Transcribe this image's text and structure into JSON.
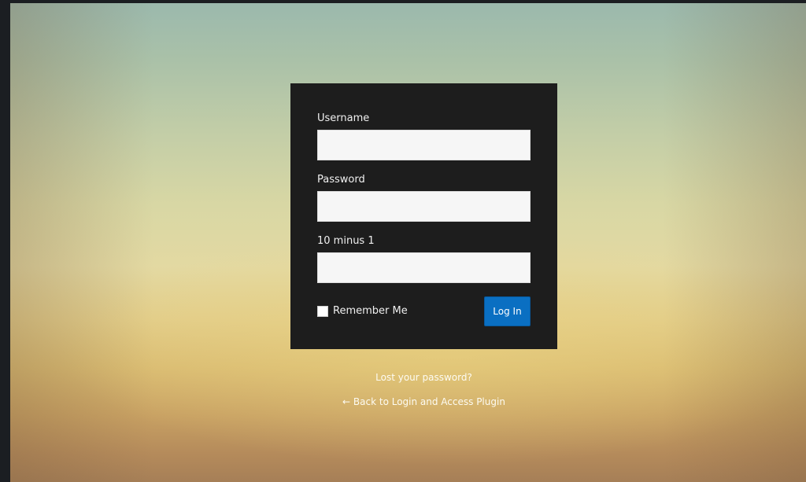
{
  "login_form": {
    "username_label": "Username",
    "username_value": "",
    "password_label": "Password",
    "password_value": "",
    "captcha_label": "10 minus 1",
    "captcha_value": "",
    "remember_label": "Remember Me",
    "remember_checked": false,
    "login_button_label": "Log In"
  },
  "links": {
    "lost_password": "Lost your password?",
    "back_to_site": "← Back to Login and Access Plugin"
  },
  "colors": {
    "form_background": "#1d1d1d",
    "button": "#0a6fc2",
    "field_background": "#f6f6f6"
  }
}
